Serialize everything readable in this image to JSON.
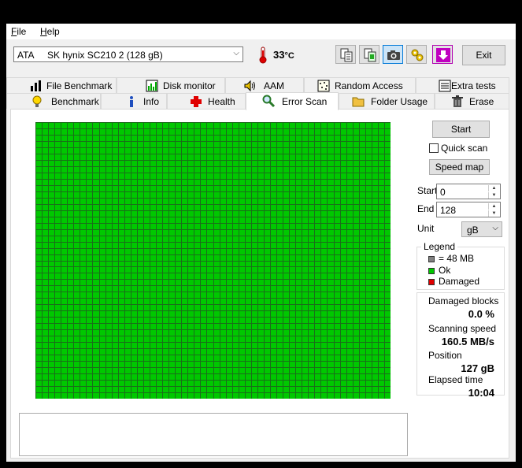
{
  "menu": {
    "file": "File",
    "file_u": "F",
    "file_rest": "ile",
    "help": "Help",
    "help_u": "H",
    "help_rest": "elp"
  },
  "toolbar": {
    "drive_type": "ATA",
    "drive_name": "SK hynix SC210 2 (128 gB)",
    "temperature": "33",
    "temperature_unit": "°C",
    "buttons": [
      "copy-text-icon",
      "copy-info-icon",
      "screenshot-icon",
      "settings-icon",
      "download-icon"
    ],
    "exit_label": "Exit"
  },
  "tabs": {
    "row1": [
      {
        "label": "File Benchmark",
        "icon": "file-benchmark-icon"
      },
      {
        "label": "Disk monitor",
        "icon": "disk-monitor-icon"
      },
      {
        "label": "AAM",
        "icon": "speaker-icon"
      },
      {
        "label": "Random Access",
        "icon": "random-access-icon"
      },
      {
        "label": "Extra tests",
        "icon": "extra-tests-icon"
      }
    ],
    "row2": [
      {
        "label": "Benchmark",
        "icon": "lightbulb-icon"
      },
      {
        "label": "Info",
        "icon": "info-icon"
      },
      {
        "label": "Health",
        "icon": "health-cross-icon"
      },
      {
        "label": "Error Scan",
        "icon": "magnifier-icon",
        "active": true
      },
      {
        "label": "Folder Usage",
        "icon": "folder-icon"
      },
      {
        "label": "Erase",
        "icon": "trash-icon"
      }
    ]
  },
  "scan": {
    "start_label": "Start",
    "quick_scan_label": "Quick scan",
    "quick_scan_checked": false,
    "speed_map_label": "Speed map",
    "start_field_label": "Start",
    "start_value": "0",
    "end_field_label": "End",
    "end_value": "128",
    "unit_label": "Unit",
    "unit_value": "gB"
  },
  "legend": {
    "title": "Legend",
    "items": [
      {
        "label": "= 48 MB",
        "color": "#808080"
      },
      {
        "label": "Ok",
        "color": "#00c800"
      },
      {
        "label": "Damaged",
        "color": "#e00000"
      }
    ]
  },
  "stats": {
    "damaged_label": "Damaged blocks",
    "damaged_value": "0.0 %",
    "speed_label": "Scanning speed",
    "speed_value": "160.5 MB/s",
    "position_label": "Position",
    "position_value": "127 gB",
    "elapsed_label": "Elapsed time",
    "elapsed_value": "10:04"
  },
  "block_map": {
    "ok_color": "#00c800",
    "line_color": "#1a6e1a",
    "damaged_fraction": 0.0
  }
}
